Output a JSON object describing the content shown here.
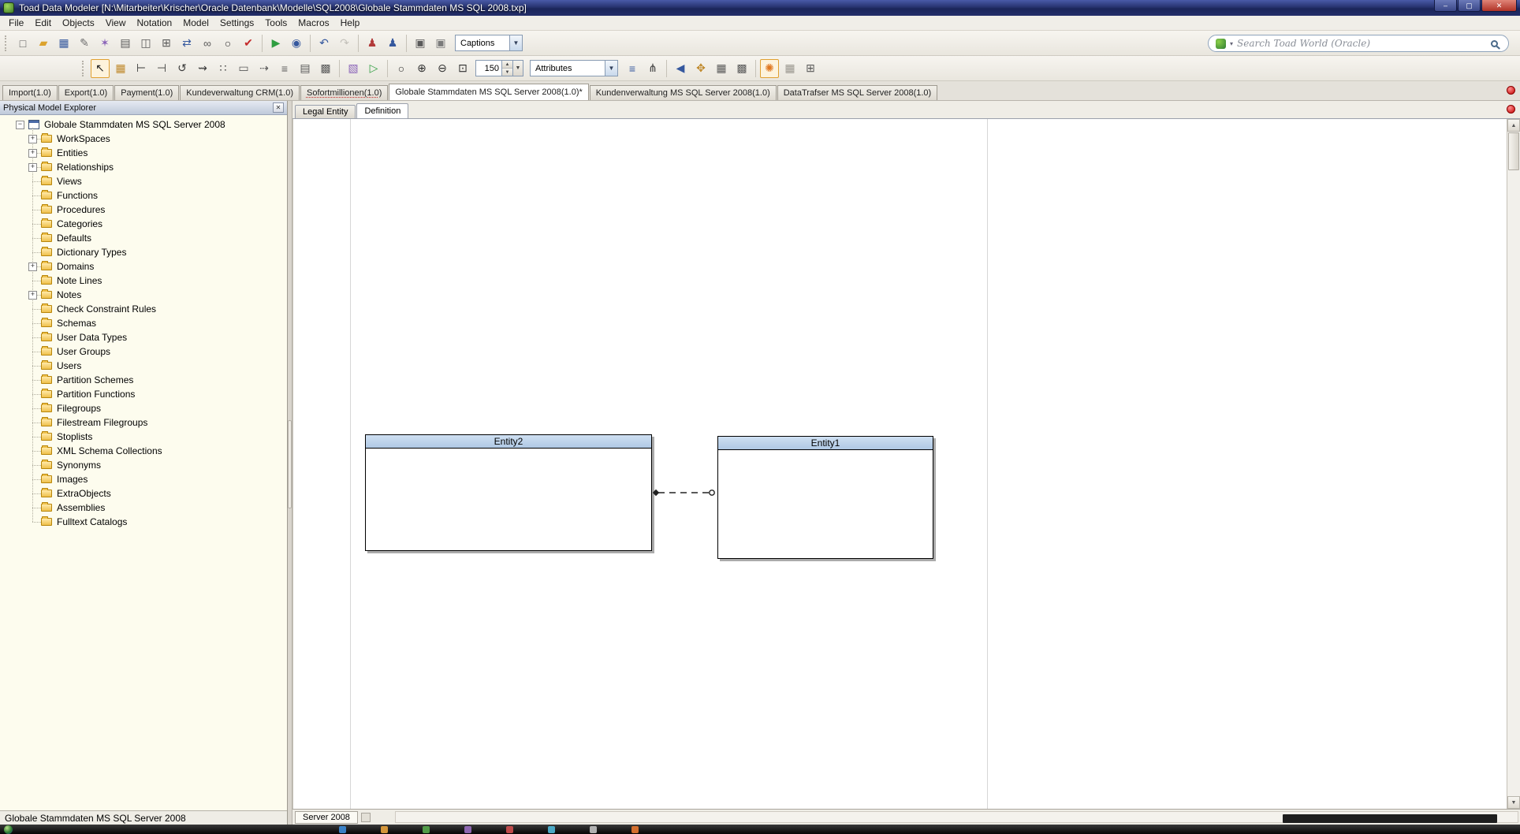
{
  "window": {
    "title": "Toad Data Modeler  [N:\\Mitarbeiter\\Krischer\\Oracle Datenbank\\Modelle\\SQL2008\\Globale Stammdaten MS SQL 2008.txp]",
    "controls": {
      "minimize": "–",
      "maximize": "▢",
      "close": "✕"
    }
  },
  "menu": {
    "items": [
      "File",
      "Edit",
      "Objects",
      "View",
      "Notation",
      "Model",
      "Settings",
      "Tools",
      "Macros",
      "Help"
    ]
  },
  "toolbar1": {
    "captions_value": "Captions",
    "icons": [
      {
        "name": "new-model-icon",
        "glyph": "□",
        "color": "#5A5A5A"
      },
      {
        "name": "open-model-icon",
        "glyph": "▰",
        "color": "#DCA32E"
      },
      {
        "name": "save-model-icon",
        "glyph": "▦",
        "color": "#35589E"
      },
      {
        "name": "script-generation-icon",
        "glyph": "✎",
        "color": "#6E6E6E"
      },
      {
        "name": "model-wizard-icon",
        "glyph": "✶",
        "color": "#8A63B8"
      },
      {
        "name": "print-icon",
        "glyph": "▤",
        "color": "#5A5A5A"
      },
      {
        "name": "print-preview-icon",
        "glyph": "◫",
        "color": "#5A5A5A"
      },
      {
        "name": "copy-model-icon",
        "glyph": "⊞",
        "color": "#5A5A5A"
      },
      {
        "name": "convert-model-icon",
        "glyph": "⇄",
        "color": "#35589E"
      },
      {
        "name": "sync-model-icon",
        "glyph": "∞",
        "color": "#5A5A5A"
      },
      {
        "name": "find-icon",
        "glyph": "○",
        "color": "#2F2F2F"
      },
      {
        "name": "verify-model-icon",
        "glyph": "✔",
        "color": "#C42B2B"
      },
      {
        "name": "generate-ddl-icon",
        "glyph": "▶",
        "color": "#2F9E41",
        "sep": true
      },
      {
        "name": "generate-report-icon",
        "glyph": "◉",
        "color": "#35589E"
      },
      {
        "name": "undo-icon",
        "glyph": "↶",
        "color": "#35589E",
        "sep": true
      },
      {
        "name": "redo-icon",
        "glyph": "↷",
        "color": "#8E8B84",
        "disabled": true
      },
      {
        "name": "checked-out-user-icon",
        "glyph": "♟",
        "color": "#B23A3A",
        "sep": true
      },
      {
        "name": "user-groups-icon",
        "glyph": "♟",
        "color": "#35589E"
      },
      {
        "name": "window-cascade-icon",
        "glyph": "▣",
        "color": "#5A5A5A",
        "sep": true
      },
      {
        "name": "window-tile-icon",
        "glyph": "▣",
        "color": "#7A7A7A"
      }
    ]
  },
  "search": {
    "placeholder": "Search Toad World (Oracle)"
  },
  "toolbar2": {
    "zoom_value": "150",
    "display_mode": "Attributes",
    "icons": [
      {
        "name": "select-tool-icon",
        "glyph": "↖",
        "color": "#1E1E1E",
        "pressed": true
      },
      {
        "name": "entity-tool-icon",
        "glyph": "▦",
        "color": "#C08A2D"
      },
      {
        "name": "identifying-relationship-tool-icon",
        "glyph": "⊢",
        "color": "#3A3A3A"
      },
      {
        "name": "non-identifying-relationship-tool-icon",
        "glyph": "⊣",
        "color": "#3A3A3A"
      },
      {
        "name": "self-relationship-tool-icon",
        "glyph": "↺",
        "color": "#3A3A3A"
      },
      {
        "name": "dashed-relationship-tool-icon",
        "glyph": "⇝",
        "color": "#3A3A3A"
      },
      {
        "name": "dotted-line-tool-icon",
        "glyph": "∷",
        "color": "#3A3A3A"
      },
      {
        "name": "note-tool-icon",
        "glyph": "▭",
        "color": "#5A5A5A"
      },
      {
        "name": "note-line-tool-icon",
        "glyph": "⇢",
        "color": "#5A5A5A"
      },
      {
        "name": "stamp-tool-icon",
        "glyph": "≡",
        "color": "#5A5A5A"
      },
      {
        "name": "title-block-tool-icon",
        "glyph": "▤",
        "color": "#5A5A5A"
      },
      {
        "name": "image-tool-icon",
        "glyph": "▩",
        "color": "#5A5A5A"
      },
      {
        "name": "workspace-format-icon",
        "glyph": "▧",
        "color": "#8A63B8",
        "sep": true
      },
      {
        "name": "workspace-run-icon",
        "glyph": "▷",
        "color": "#2F9E41"
      },
      {
        "name": "zoom-tool-icon",
        "glyph": "○",
        "color": "#2F2F2F",
        "sep": true
      },
      {
        "name": "zoom-in-icon",
        "glyph": "⊕",
        "color": "#2F2F2F"
      },
      {
        "name": "zoom-out-icon",
        "glyph": "⊖",
        "color": "#2F2F2F"
      },
      {
        "name": "zoom-fit-icon",
        "glyph": "⊡",
        "color": "#2F2F2F"
      }
    ],
    "icons2": [
      {
        "name": "attribute-list-icon",
        "glyph": "≡",
        "color": "#35589E"
      },
      {
        "name": "hierarchy-view-icon",
        "glyph": "⋔",
        "color": "#3A3A3A"
      },
      {
        "name": "navigate-back-icon",
        "glyph": "◀",
        "color": "#35589E",
        "sep": true
      },
      {
        "name": "pan-tool-icon",
        "glyph": "✥",
        "color": "#C08A2D"
      },
      {
        "name": "small-grid-icon",
        "glyph": "▦",
        "color": "#5A5A5A"
      },
      {
        "name": "grid-properties-icon",
        "glyph": "▩",
        "color": "#5A5A5A"
      },
      {
        "name": "auto-layout-icon",
        "glyph": "✺",
        "color": "#E07820",
        "pressed": true,
        "sep": true
      },
      {
        "name": "show-grid-icon",
        "glyph": "▦",
        "color": "#9A978F"
      },
      {
        "name": "snap-to-grid-icon",
        "glyph": "⊞",
        "color": "#5A5A5A"
      }
    ]
  },
  "doc_tabs": [
    {
      "label": "Import(1.0)"
    },
    {
      "label": "Export(1.0)"
    },
    {
      "label": "Payment(1.0)"
    },
    {
      "label": "Kundeverwaltung CRM(1.0)"
    },
    {
      "label": "Sofortmillionen(1.0)",
      "flagged": true
    },
    {
      "label": "Globale Stammdaten MS SQL Server 2008(1.0)*",
      "active": true
    },
    {
      "label": "Kundenverwaltung MS SQL Server 2008(1.0)"
    },
    {
      "label": "DataTrafser MS SQL Server 2008(1.0)"
    }
  ],
  "explorer": {
    "title": "Physical Model Explorer",
    "close_glyph": "✕",
    "root": "Globale Stammdaten MS SQL Server 2008",
    "items": [
      {
        "label": "WorkSpaces",
        "expandable": true
      },
      {
        "label": "Entities",
        "expandable": true
      },
      {
        "label": "Relationships",
        "expandable": true
      },
      {
        "label": "Views"
      },
      {
        "label": "Functions"
      },
      {
        "label": "Procedures"
      },
      {
        "label": "Categories"
      },
      {
        "label": "Defaults"
      },
      {
        "label": "Dictionary Types"
      },
      {
        "label": "Domains",
        "expandable": true
      },
      {
        "label": "Note Lines"
      },
      {
        "label": "Notes",
        "expandable": true
      },
      {
        "label": "Check Constraint Rules"
      },
      {
        "label": "Schemas"
      },
      {
        "label": "User Data Types"
      },
      {
        "label": "User Groups"
      },
      {
        "label": "Users"
      },
      {
        "label": "Partition Schemes"
      },
      {
        "label": "Partition Functions"
      },
      {
        "label": "Filegroups"
      },
      {
        "label": "Filestream Filegroups"
      },
      {
        "label": "Stoplists"
      },
      {
        "label": "XML Schema Collections"
      },
      {
        "label": "Synonyms"
      },
      {
        "label": "Images"
      },
      {
        "label": "ExtraObjects"
      },
      {
        "label": "Assemblies"
      },
      {
        "label": "Fulltext Catalogs"
      }
    ],
    "status": "Globale Stammdaten MS SQL Server 2008"
  },
  "workspace": {
    "subtabs": [
      {
        "label": "Legal Entity"
      },
      {
        "label": "Definition",
        "active": true
      }
    ],
    "entities": [
      {
        "name": "Entity2"
      },
      {
        "name": "Entity1"
      }
    ],
    "relationship": {
      "from": "Entity2",
      "to": "Entity1",
      "style": "dashed"
    },
    "sheet_label": "Server 2008"
  },
  "taskbar": {
    "icons": [
      {
        "color": "#3C8CD8"
      },
      {
        "color": "#E8A33D"
      },
      {
        "color": "#58A84C"
      },
      {
        "color": "#9A6FC0"
      },
      {
        "color": "#D05050"
      },
      {
        "color": "#50B8D8"
      },
      {
        "color": "#C2C2C2"
      },
      {
        "color": "#E87830"
      }
    ]
  }
}
